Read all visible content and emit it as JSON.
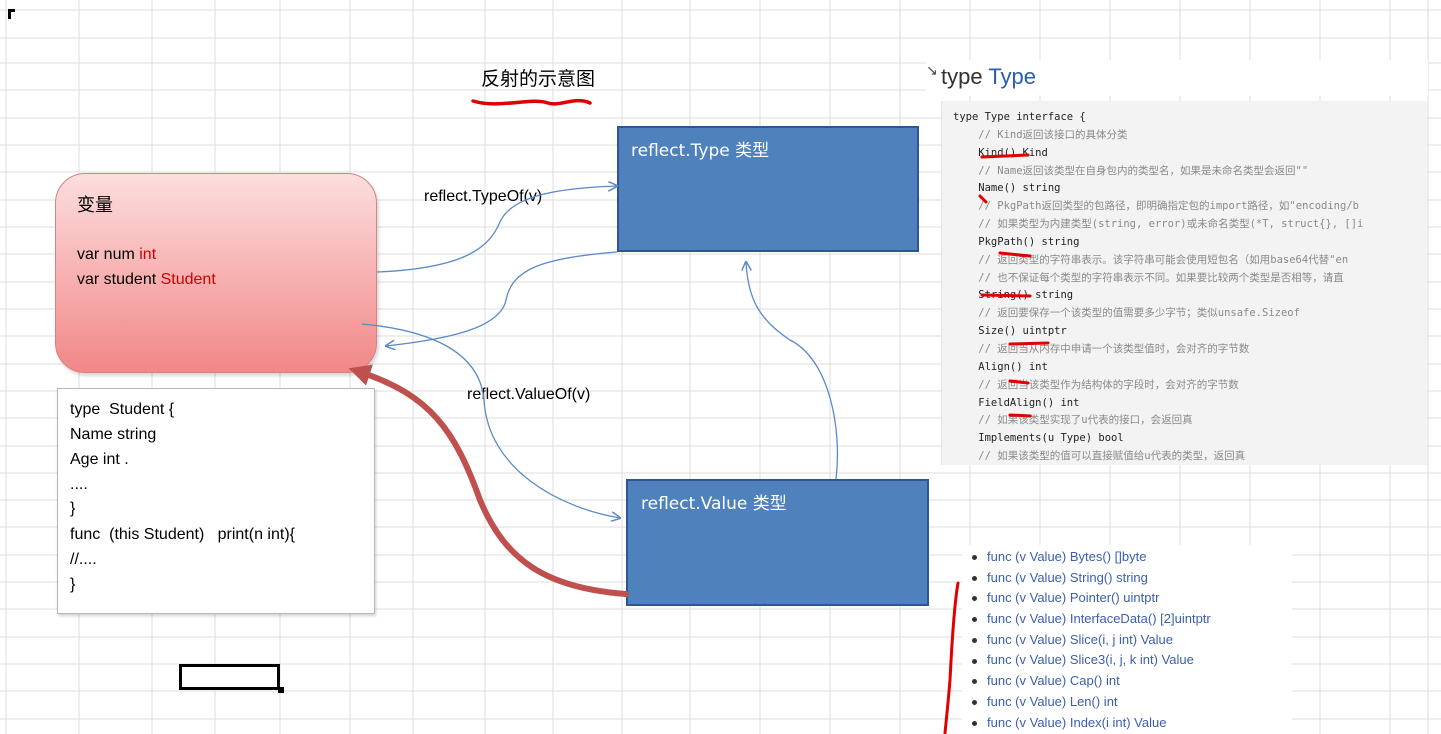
{
  "title": "反射的示意图",
  "variable_box": {
    "title": "变量",
    "lines": [
      {
        "prefix": "var num ",
        "type": "int"
      },
      {
        "prefix": "var student ",
        "type": "Student"
      }
    ]
  },
  "struct_code": [
    "type  Student {",
    "Name string",
    "Age int .",
    "....",
    "}",
    "func  (this Student)   print(n int){",
    "//....",
    "}"
  ],
  "type_box": {
    "label": "reflect.Type 类型"
  },
  "value_box": {
    "label": "reflect.Value 类型"
  },
  "arrows": {
    "typeof": "reflect.TypeOf(v)",
    "valueof": "reflect.ValueOf(v)"
  },
  "type_doc": {
    "title_kw": "type",
    "title_name": "Type",
    "lines": [
      {
        "code": "type Type interface {",
        "comment": ""
      },
      {
        "code": "",
        "comment": "    // Kind返回该接口的具体分类"
      },
      {
        "code": "    Kind() Kind",
        "comment": ""
      },
      {
        "code": "",
        "comment": "    // Name返回该类型在自身包内的类型名，如果是未命名类型会返回\"\""
      },
      {
        "code": "    Name() string",
        "comment": ""
      },
      {
        "code": "",
        "comment": "    // PkgPath返回类型的包路径，即明确指定包的import路径，如\"encoding/b"
      },
      {
        "code": "",
        "comment": "    // 如果类型为内建类型(string, error)或未命名类型(*T, struct{}, []i"
      },
      {
        "code": "    PkgPath() string",
        "comment": ""
      },
      {
        "code": "",
        "comment": "    // 返回类型的字符串表示。该字符串可能会使用短包名（如用base64代替\"en"
      },
      {
        "code": "",
        "comment": "    // 也不保证每个类型的字符串表示不同。如果要比较两个类型是否相等，请直"
      },
      {
        "code": "    String() string",
        "comment": ""
      },
      {
        "code": "",
        "comment": "    // 返回要保存一个该类型的值需要多少字节；类似unsafe.Sizeof"
      },
      {
        "code": "    Size() uintptr",
        "comment": ""
      },
      {
        "code": "",
        "comment": "    // 返回当从内存中申请一个该类型值时，会对齐的字节数"
      },
      {
        "code": "    Align() int",
        "comment": ""
      },
      {
        "code": "",
        "comment": "    // 返回当该类型作为结构体的字段时，会对齐的字节数"
      },
      {
        "code": "    FieldAlign() int",
        "comment": ""
      },
      {
        "code": "",
        "comment": "    // 如果该类型实现了u代表的接口，会返回真"
      },
      {
        "code": "    Implements(u Type) bool",
        "comment": ""
      },
      {
        "code": "",
        "comment": "    // 如果该类型的值可以直接赋值给u代表的类型，返回真"
      }
    ]
  },
  "value_methods": [
    "func (v Value) Bytes() []byte",
    "func (v Value) String() string",
    "func (v Value) Pointer() uintptr",
    "func (v Value) InterfaceData() [2]uintptr",
    "func (v Value) Slice(i, j int) Value",
    "func (v Value) Slice3(i, j, k int) Value",
    "func (v Value) Cap() int",
    "func (v Value) Len() int",
    "func (v Value) Index(i int) Value"
  ],
  "colors": {
    "box_blue": "#4f81bd",
    "var_red": "#f28787",
    "highlight_red": "#e00000",
    "link_blue": "#3b5fae",
    "arrow_blue": "#5b8ac8",
    "big_arrow": "#c0504d"
  }
}
